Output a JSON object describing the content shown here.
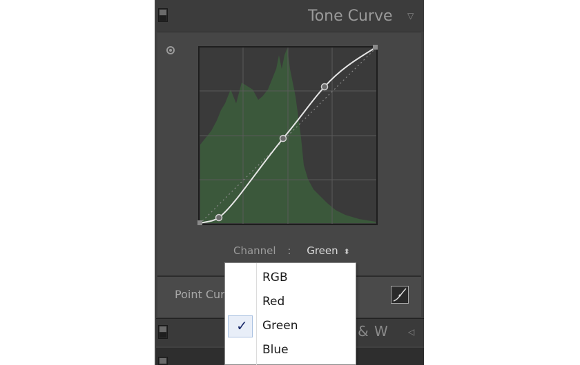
{
  "panel": {
    "title": "Tone Curve",
    "collapse_icon": "triangle-down-icon",
    "target_icon": "target-adjust-icon"
  },
  "channel": {
    "label": "Channel",
    "colon": ":",
    "value": "Green",
    "stepper_icon": "up-down-arrows-icon"
  },
  "point_curve": {
    "label": "Point Curve",
    "edit_icon": "curve-edit-icon"
  },
  "next_panel": {
    "title": "B & W",
    "collapse_icon": "triangle-left-icon"
  },
  "menu": {
    "items": [
      {
        "label": "RGB",
        "checked": false
      },
      {
        "label": "Red",
        "checked": false
      },
      {
        "label": "Green",
        "checked": true
      },
      {
        "label": "Blue",
        "checked": false
      }
    ],
    "check_glyph": "✓"
  },
  "colors": {
    "panel_bg": "#404040",
    "histogram": "#3d5a3d",
    "curve": "#e6e6e6"
  }
}
